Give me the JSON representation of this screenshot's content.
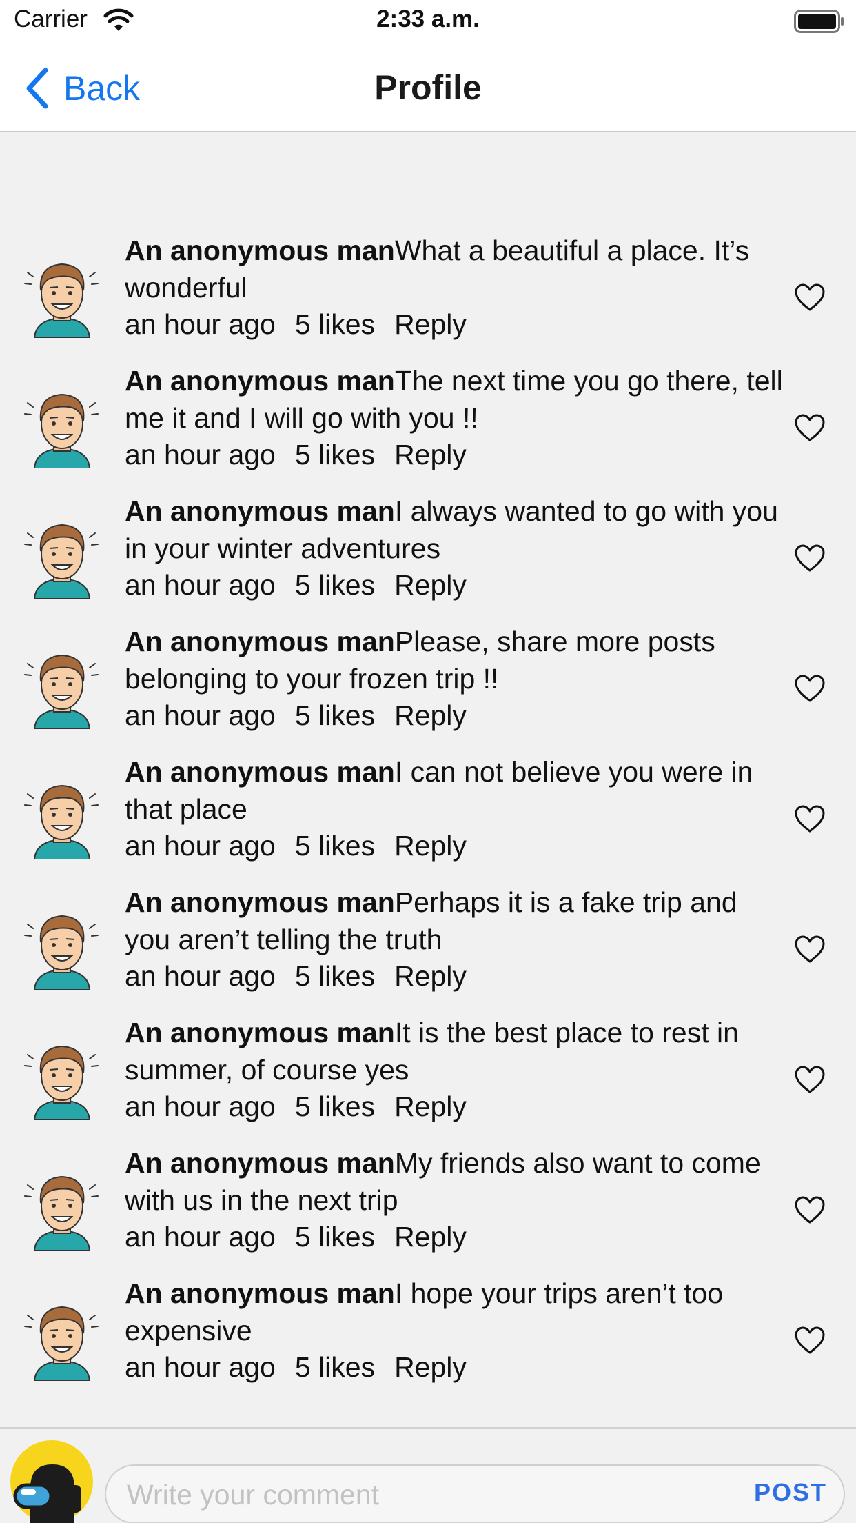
{
  "status_bar": {
    "carrier": "Carrier",
    "time": "2:33 a.m."
  },
  "nav": {
    "back_label": "Back",
    "title": "Profile"
  },
  "comments": [
    {
      "author": "An anonymous man",
      "text": "What a beautiful a place. It’s wonderful",
      "time": "an hour ago",
      "likes": "5 likes",
      "reply": "Reply"
    },
    {
      "author": "An anonymous man",
      "text": "The next time you go there, tell me it and I will go with you !!",
      "time": "an hour ago",
      "likes": "5 likes",
      "reply": "Reply"
    },
    {
      "author": "An anonymous man",
      "text": "I always wanted to go with you in your winter adventures",
      "time": "an hour ago",
      "likes": "5 likes",
      "reply": "Reply"
    },
    {
      "author": "An anonymous man",
      "text": "Please, share more posts belonging to your frozen trip !!",
      "time": "an hour ago",
      "likes": "5 likes",
      "reply": "Reply"
    },
    {
      "author": "An anonymous man",
      "text": "I can not believe you were in that place",
      "time": "an hour ago",
      "likes": "5 likes",
      "reply": "Reply"
    },
    {
      "author": "An anonymous man",
      "text": "Perhaps it is a fake trip and you aren’t telling the truth",
      "time": "an hour ago",
      "likes": "5 likes",
      "reply": "Reply"
    },
    {
      "author": "An anonymous man",
      "text": "It is the best place to rest in summer, of course yes",
      "time": "an hour ago",
      "likes": "5 likes",
      "reply": "Reply"
    },
    {
      "author": "An anonymous man",
      "text": "My friends also want to come with us in the next trip",
      "time": "an hour ago",
      "likes": "5 likes",
      "reply": "Reply"
    },
    {
      "author": "An anonymous man",
      "text": "I hope your trips aren’t too expensive",
      "time": "an hour ago",
      "likes": "5 likes",
      "reply": "Reply"
    }
  ],
  "composer": {
    "placeholder": "Write your comment",
    "value": "",
    "post_label": "POST"
  },
  "icons": {
    "wifi": "wifi-icon",
    "battery": "battery-icon",
    "back": "chevron-left-icon",
    "like": "heart-outline-icon",
    "comment_avatar": "man-avatar-icon",
    "user_avatar": "crewmate-avatar-icon"
  },
  "colors": {
    "accent": "#1577ef",
    "post": "#2f6fe4",
    "background": "#f1f1f1",
    "avatar_bg": "#f7d51d"
  }
}
